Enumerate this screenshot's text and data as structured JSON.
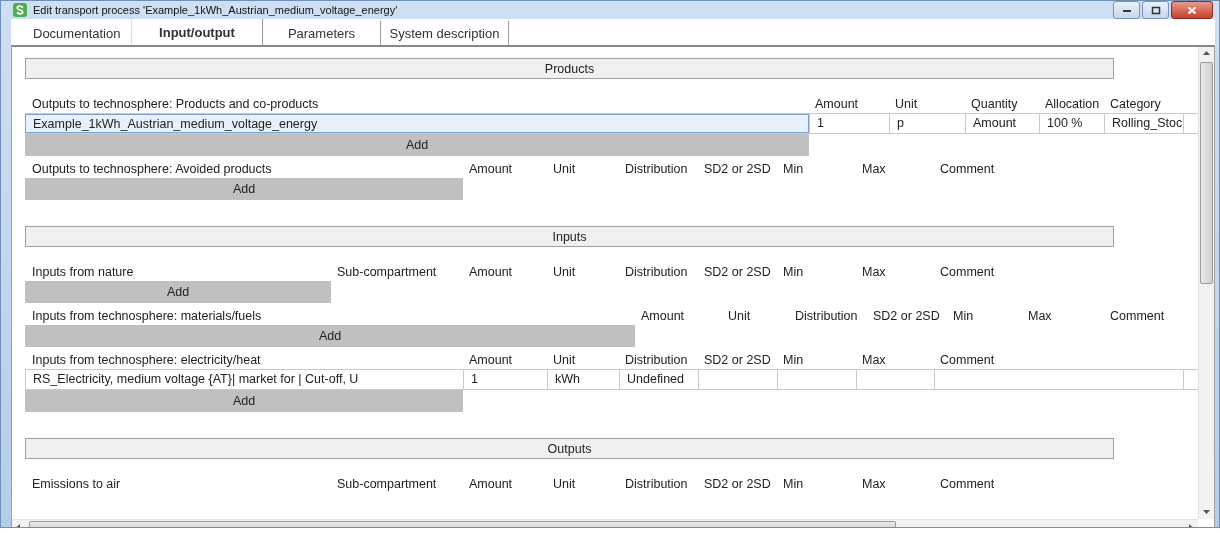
{
  "window": {
    "title": "Edit transport process 'Example_1kWh_Austrian_medium_voltage_energy'"
  },
  "tabs": [
    {
      "label": "Documentation",
      "selected": false
    },
    {
      "label": "Input/output",
      "selected": true
    },
    {
      "label": "Parameters",
      "selected": false
    },
    {
      "label": "System description",
      "selected": false
    }
  ],
  "sections": [
    {
      "title": "Products",
      "groups": [
        {
          "kind": "products",
          "columns": [
            "Outputs to technosphere: Products and co-products",
            "Amount",
            "Unit",
            "Quantity",
            "Allocation",
            "Category"
          ],
          "rows": [
            {
              "cells": [
                "Example_1kWh_Austrian_medium_voltage_energy",
                "1",
                "p",
                "Amount",
                "100 %",
                "Rolling_Stoc"
              ],
              "selected": true
            }
          ],
          "add_label": "Add"
        },
        {
          "kind": "flows",
          "columns": [
            "Outputs to technosphere: Avoided products",
            "Amount",
            "Unit",
            "Distribution",
            "SD2 or 2SD",
            "Min",
            "Max",
            "Comment"
          ],
          "add_label": "Add"
        }
      ]
    },
    {
      "title": "Inputs",
      "groups": [
        {
          "kind": "flows_sub",
          "columns": [
            "Inputs from nature",
            "Sub-compartment",
            "Amount",
            "Unit",
            "Distribution",
            "SD2 or 2SD",
            "Min",
            "Max",
            "Comment"
          ],
          "add_label": "Add"
        },
        {
          "kind": "materials",
          "columns": [
            "Inputs from technosphere: materials/fuels",
            "Amount",
            "Unit",
            "Distribution",
            "SD2 or 2SD",
            "Min",
            "Max",
            "Comment"
          ],
          "add_label": "Add"
        },
        {
          "kind": "flows",
          "columns": [
            "Inputs from technosphere: electricity/heat",
            "Amount",
            "Unit",
            "Distribution",
            "SD2 or 2SD",
            "Min",
            "Max",
            "Comment"
          ],
          "rows": [
            {
              "cells": [
                "RS_Electricity, medium voltage {AT}| market for | Cut-off, U",
                "1",
                "kWh",
                "Undefined"
              ],
              "selected": false
            }
          ],
          "add_label": "Add"
        }
      ]
    },
    {
      "title": "Outputs",
      "groups": [
        {
          "kind": "flows_sub",
          "columns": [
            "Emissions to air",
            "Sub-compartment",
            "Amount",
            "Unit",
            "Distribution",
            "SD2 or 2SD",
            "Min",
            "Max",
            "Comment"
          ]
        }
      ]
    }
  ]
}
